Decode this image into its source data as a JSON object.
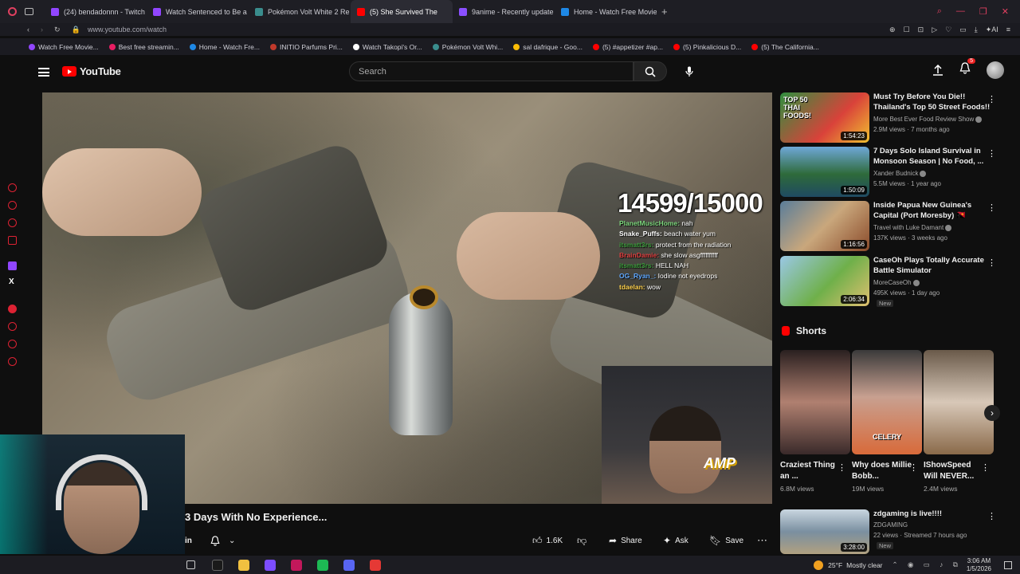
{
  "browser": {
    "tabs": [
      {
        "label": "(24) bendadonnn - Twitch",
        "color": "#9146ff",
        "active": false
      },
      {
        "label": "Watch Sentenced to Be a",
        "color": "#9146ff",
        "active": false
      },
      {
        "label": "Pokémon Volt White 2 Re",
        "color": "#3a8d8d",
        "active": false
      },
      {
        "label": "(5) She Survived The",
        "color": "#ff0000",
        "active": true
      },
      {
        "label": "9anime - Recently update",
        "color": "#8a4fff",
        "active": false
      },
      {
        "label": "Home - Watch Free Movie",
        "color": "#1e88e5",
        "active": false
      }
    ],
    "url": "www.youtube.com/watch",
    "bookmarks": [
      {
        "label": "Watch Free Movie...",
        "color": "#9146ff"
      },
      {
        "label": "Best free streamin...",
        "color": "#e91e63"
      },
      {
        "label": "Home - Watch Fre...",
        "color": "#1e88e5"
      },
      {
        "label": "INITIO Parfums Pri...",
        "color": "#c0392b"
      },
      {
        "label": "Watch Takopi's Or...",
        "color": "#ffffff"
      },
      {
        "label": "Pokémon Volt Whi...",
        "color": "#3a8d8d"
      },
      {
        "label": "sal dafrique - Goo...",
        "color": "#fbbc05"
      },
      {
        "label": "(5) #appetizer #ap...",
        "color": "#ff0000"
      },
      {
        "label": "(5) Pinkalicious D...",
        "color": "#ff0000"
      },
      {
        "label": "(5) The California...",
        "color": "#ff0000"
      }
    ]
  },
  "youtube": {
    "logo_text": "YouTube",
    "search_placeholder": "Search",
    "notification_count": "5"
  },
  "video": {
    "counter": "14599/15000",
    "chat": [
      {
        "user": "PlanetMusicHome:",
        "msg": "nah",
        "color": "#7cd67c"
      },
      {
        "user": "Snake_Puffs:",
        "msg": "beach water yum",
        "color": "#ffffff"
      },
      {
        "user": "itsmatt3rs:",
        "msg": "protect from the radiation",
        "color": "#3c9b3c"
      },
      {
        "user": "BrainDamie:",
        "msg": "she slow asgffffffffff",
        "color": "#e04040"
      },
      {
        "user": "itsmatt3rs:",
        "msg": "HELL NAH",
        "color": "#3c9b3c"
      },
      {
        "user": "OG_Ryan_:",
        "msg": "Iodine not eyedrops",
        "color": "#5fa8ff"
      },
      {
        "user": "tdaelan:",
        "msg": "wow",
        "color": "#ffd24d"
      }
    ],
    "cam_logo": "AMP",
    "title": "3 Days With No Experience...",
    "likes": "1.6K",
    "share_label": "Share",
    "ask_label": "Ask",
    "save_label": "Save",
    "in_label": "in"
  },
  "recommendations": [
    {
      "title": "Must Try Before You Die!! Thailand's Top 50 Street Foods!!",
      "channel": "More Best Ever Food Review Show",
      "meta": "2.9M views · 7 months ago",
      "duration": "1:54:23",
      "badge": "",
      "thumb_text": "TOP 50 THAI FOODS!",
      "bg": "linear-gradient(135deg,#2f8f3f,#d9423a 60%,#f0c030)"
    },
    {
      "title": "7 Days Solo Island Survival in Monsoon Season | No Food, ...",
      "channel": "Xander Budnick",
      "meta": "5.5M views · 1 year ago",
      "duration": "1:50:09",
      "badge": "",
      "thumb_text": "",
      "bg": "linear-gradient(180deg,#6fa8d8,#2e6a3a 55%,#1f4a62)"
    },
    {
      "title": "Inside Papua New Guinea's Capital (Port Moresby) 🇵🇬",
      "channel": "Travel with Luke Damant",
      "meta": "137K views · 3 weeks ago",
      "duration": "1:16:56",
      "badge": "",
      "thumb_text": "",
      "bg": "linear-gradient(135deg,#5a7d9a,#c9a77c 50%,#8a4a2a)"
    },
    {
      "title": "CaseOh Plays Totally Accurate Battle Simulator",
      "channel": "MoreCaseOh",
      "meta": "495K views · 1 day ago",
      "duration": "2:06:34",
      "badge": "New",
      "thumb_text": "",
      "bg": "linear-gradient(135deg,#9ac8e6,#6fb04a 55%,#e0c070)"
    }
  ],
  "shorts": {
    "header": "Shorts",
    "items": [
      {
        "title": "Craziest Thing an ...",
        "views": "6.8M views",
        "bg": "linear-gradient(180deg,#2a2020,#b08070 50%,#3a2a2a)",
        "overlay": ""
      },
      {
        "title": "Why does Millie Bobb...",
        "views": "19M views",
        "bg": "linear-gradient(180deg,#3a3a3a,#c8a090 45%,#d86a3a)",
        "overlay": "CELERY"
      },
      {
        "title": "IShowSpeed Will NEVER...",
        "views": "2.4M views",
        "bg": "linear-gradient(180deg,#6a5a4a,#d8c8b8 50%,#8a6a4a)",
        "overlay": ""
      }
    ]
  },
  "live": {
    "title": "zdgaming is live!!!!",
    "channel": "ZDGAMING",
    "meta": "22 views · Streamed 7 hours ago",
    "badge": "New",
    "duration": "3:28:00"
  },
  "taskbar": {
    "weather": "25°F",
    "condition": "Mostly clear",
    "time": "3:06 AM",
    "date": "1/5/2026",
    "apps": [
      "#1a1a1a",
      "#f0c040",
      "#7c4dff",
      "#c2185b",
      "#1db954",
      "#5865f2",
      "#e53935"
    ]
  }
}
